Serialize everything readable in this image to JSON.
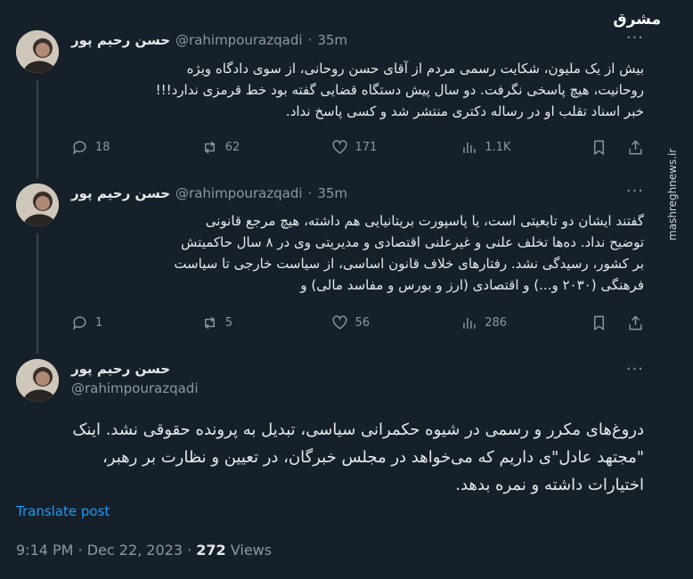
{
  "logo_text": "مشرق",
  "watermark": "mashreghnews.ir",
  "tweets": [
    {
      "name": "حسن رحیم پور",
      "handle": "@rahimpourazqadi",
      "dot": "·",
      "time": "35m",
      "more": "···",
      "lines": [
        "بیش از یک ملیون، شکایت رسمی مردم از آقای حسن روحانی، از سوی دادگاه ویژه",
        "روحانیت، هیچ پاسخی نگرفت. دو سال پیش دستگاه قضایی گفته بود خط قرمزی ندارد!!!",
        "خبر اسناد تقلب او در رساله دکتری منتشر شد و کسی پاسخ نداد."
      ],
      "replies": "18",
      "reposts": "62",
      "likes": "171",
      "views": "1.1K"
    },
    {
      "name": "حسن رحیم پور",
      "handle": "@rahimpourazqadi",
      "dot": "·",
      "time": "35m",
      "more": "···",
      "lines": [
        "گفتند ایشان دو تابعیتی است، یا پاسپورت بریتانیایی هم داشته، هیچ مرجع قانونی",
        "توضیح نداد. ده‌ها تخلف علنی و غیرعلنی اقتصادی و مدیریتی وی در ۸ سال حاکمیتش",
        "بر کشور، رسیدگی نشد. رفتارهای خلاف قانون اساسی، از سیاست خارجی تا سیاست",
        "فرهنگی (۲۰۳۰ و...) و اقتصادی (ارز و بورس و مفاسد مالی) و"
      ],
      "replies": "1",
      "reposts": "5",
      "likes": "56",
      "views": "286"
    }
  ],
  "main_tweet": {
    "name": "حسن رحیم پور",
    "handle": "@rahimpourazqadi",
    "more": "···",
    "lines": [
      "دروغ‌های مکرر و رسمی در شیوه حکمرانی سیاسی، تبدیل به پرونده حقوقی نشد. اینک",
      "\"مجتهد عادل\"ی داریم که می‌خواهد در مجلس خبرگان، در تعیین و نظارت بر رهبر،",
      "اختیارات داشته و نمره بدهد."
    ],
    "translate": "Translate post",
    "time_date": "9:14 PM · Dec 22, 2023 · ",
    "views_count": "272",
    "views_label": " Views"
  }
}
